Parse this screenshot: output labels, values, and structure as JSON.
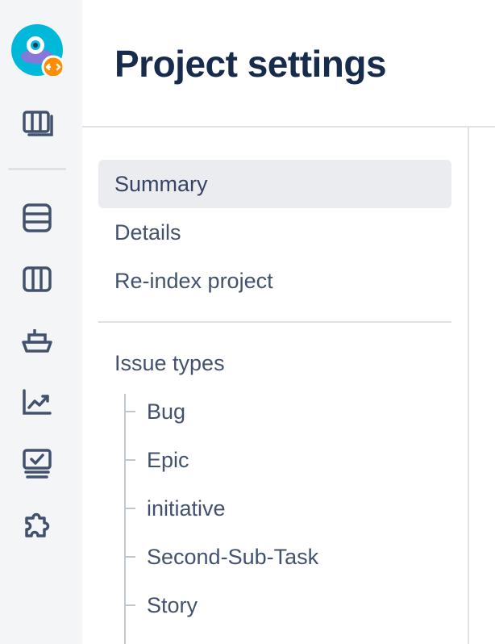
{
  "header": {
    "title": "Project settings"
  },
  "rail": {
    "items": [
      {
        "icon": "project-avatar-icon"
      },
      {
        "icon": "boards-icon"
      },
      {
        "icon": "backlog-icon"
      },
      {
        "icon": "board-columns-icon"
      },
      {
        "icon": "releases-ship-icon"
      },
      {
        "icon": "reports-chart-icon"
      },
      {
        "icon": "issues-monitor-icon"
      },
      {
        "icon": "apps-puzzle-icon"
      }
    ],
    "avatar_badge_color": "#ff8b00",
    "avatar_color": "#00b8d9"
  },
  "nav": {
    "summary": "Summary",
    "details": "Details",
    "reindex": "Re-index project",
    "issue_types": "Issue types",
    "issue_type_items": [
      "Bug",
      "Epic",
      "initiative",
      "Second-Sub-Task",
      "Story"
    ]
  },
  "colors": {
    "title": "#172b4d",
    "text": "#42526e",
    "active_bg": "#ebecf0",
    "rail_bg": "#f4f5f7",
    "icon": "#42526e"
  }
}
